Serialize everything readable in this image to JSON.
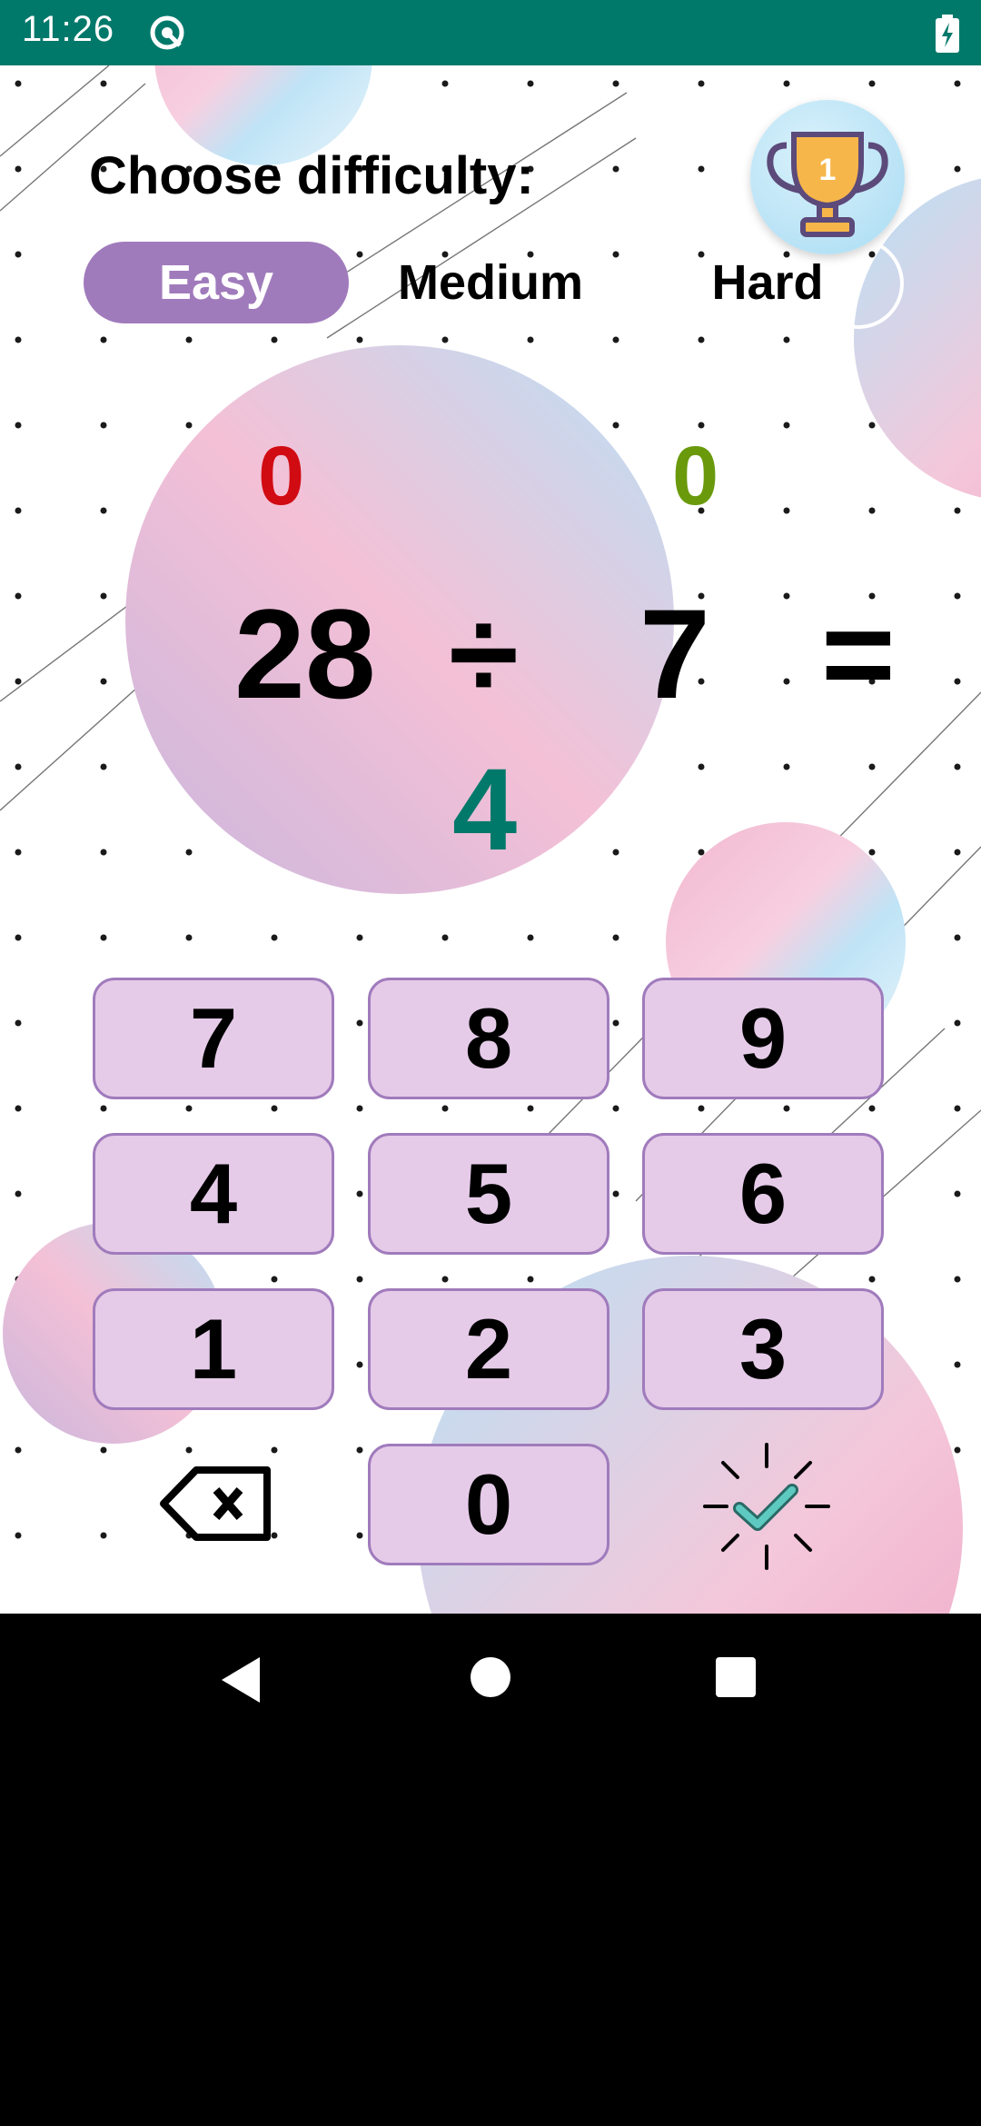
{
  "status_bar": {
    "time": "11:26",
    "app_icon": "sync-icon",
    "battery_icon": "battery-charging-icon"
  },
  "header": {
    "title": "Choose difficulty:",
    "difficulty_options": [
      {
        "label": "Easy",
        "selected": true
      },
      {
        "label": "Medium",
        "selected": false
      },
      {
        "label": "Hard",
        "selected": false
      }
    ],
    "trophy": {
      "icon": "trophy-icon",
      "rank": "1"
    }
  },
  "scores": {
    "wrong": "0",
    "correct": "0",
    "wrong_color": "#d10b12",
    "correct_color": "#6a9a0c"
  },
  "problem": {
    "operand_a": "28",
    "operator": "÷",
    "operand_b": "7",
    "equals": "=",
    "answer": "4"
  },
  "keypad": {
    "keys": [
      "7",
      "8",
      "9",
      "4",
      "5",
      "6",
      "1",
      "2",
      "3",
      "0"
    ],
    "backspace_icon": "backspace-icon",
    "submit_icon": "check-sparkle-icon"
  },
  "nav_bar": {
    "back_icon": "back-triangle-icon",
    "home_icon": "home-circle-icon",
    "recents_icon": "recents-square-icon"
  },
  "colors": {
    "accent": "#a07bbc",
    "key_fill": "#e6cbe9",
    "status_bar": "#00796b"
  }
}
